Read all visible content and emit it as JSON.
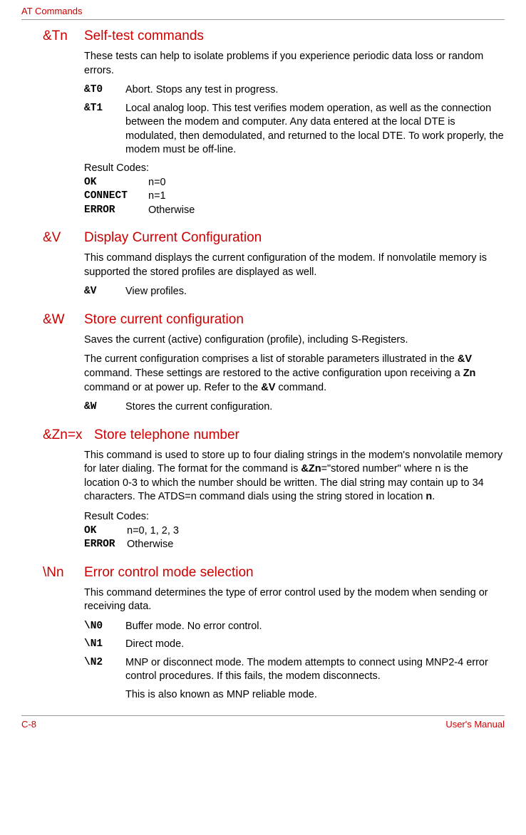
{
  "header": {
    "title": "AT Commands"
  },
  "sections": {
    "tn": {
      "prefix": "&Tn",
      "title": "Self-test commands",
      "intro": "These tests can help to isolate problems if you experience periodic data loss or random errors.",
      "defs": [
        {
          "code": "&T0",
          "desc": "Abort. Stops any test in progress."
        },
        {
          "code": "&T1",
          "desc": "Local analog loop. This test verifies modem operation, as well as the connection between the modem and computer. Any data entered at the local DTE is modulated, then demodulated, and returned to the local DTE. To work properly, the modem must be off-line."
        }
      ],
      "result_label": "Result Codes:",
      "results": [
        {
          "code": "OK",
          "val": "n=0"
        },
        {
          "code": "CONNECT",
          "val": "n=1"
        },
        {
          "code": "ERROR",
          "val": "Otherwise"
        }
      ]
    },
    "v": {
      "prefix": "&V",
      "title": "Display Current Configuration",
      "intro": "This command displays the current configuration of the modem. If nonvolatile memory is supported the stored profiles are displayed as well.",
      "defs": [
        {
          "code": "&V",
          "desc": "View profiles."
        }
      ]
    },
    "w": {
      "prefix": "&W",
      "title": "Store current configuration",
      "intro1": "Saves the current (active) configuration (profile), including S-Registers.",
      "intro2_a": "The current configuration comprises a list of storable parameters illustrated in the ",
      "intro2_b": "&V",
      "intro2_c": " command. These settings are restored to the active configuration upon receiving a ",
      "intro2_d": "Zn",
      "intro2_e": " command or at power up. Refer to the ",
      "intro2_f": "&V",
      "intro2_g": " command.",
      "defs": [
        {
          "code": "&W",
          "desc": "Stores the current configuration."
        }
      ]
    },
    "zn": {
      "prefix": "&Zn=x",
      "title": "Store telephone number",
      "intro_a": "This command is used to store up to four dialing strings in the modem's nonvolatile memory for later dialing. The format for the command is ",
      "intro_b": "&Zn",
      "intro_c": "=\"stored number\" where n is the location 0-3 to which the number should be written. The dial string may contain up to 34 characters. The ATDS=n command dials using the string stored in location ",
      "intro_d": "n",
      "intro_e": ".",
      "result_label": "Result Codes:",
      "results": [
        {
          "code": "OK",
          "val": "n=0, 1, 2, 3"
        },
        {
          "code": "ERROR",
          "val": "Otherwise"
        }
      ]
    },
    "nn": {
      "prefix": "\\Nn",
      "title": "Error control mode selection",
      "intro": "This command determines the type of error control used by the modem when sending or receiving data.",
      "defs": [
        {
          "code": "\\N0",
          "desc": "Buffer mode. No error control."
        },
        {
          "code": "\\N1",
          "desc": "Direct mode."
        },
        {
          "code": "\\N2",
          "desc": "MNP or disconnect mode. The modem attempts to connect using MNP2-4 error control procedures. If this fails, the modem disconnects.",
          "desc2": "This is also known as MNP reliable mode."
        }
      ]
    }
  },
  "footer": {
    "page": "C-8",
    "label": "User's Manual"
  }
}
